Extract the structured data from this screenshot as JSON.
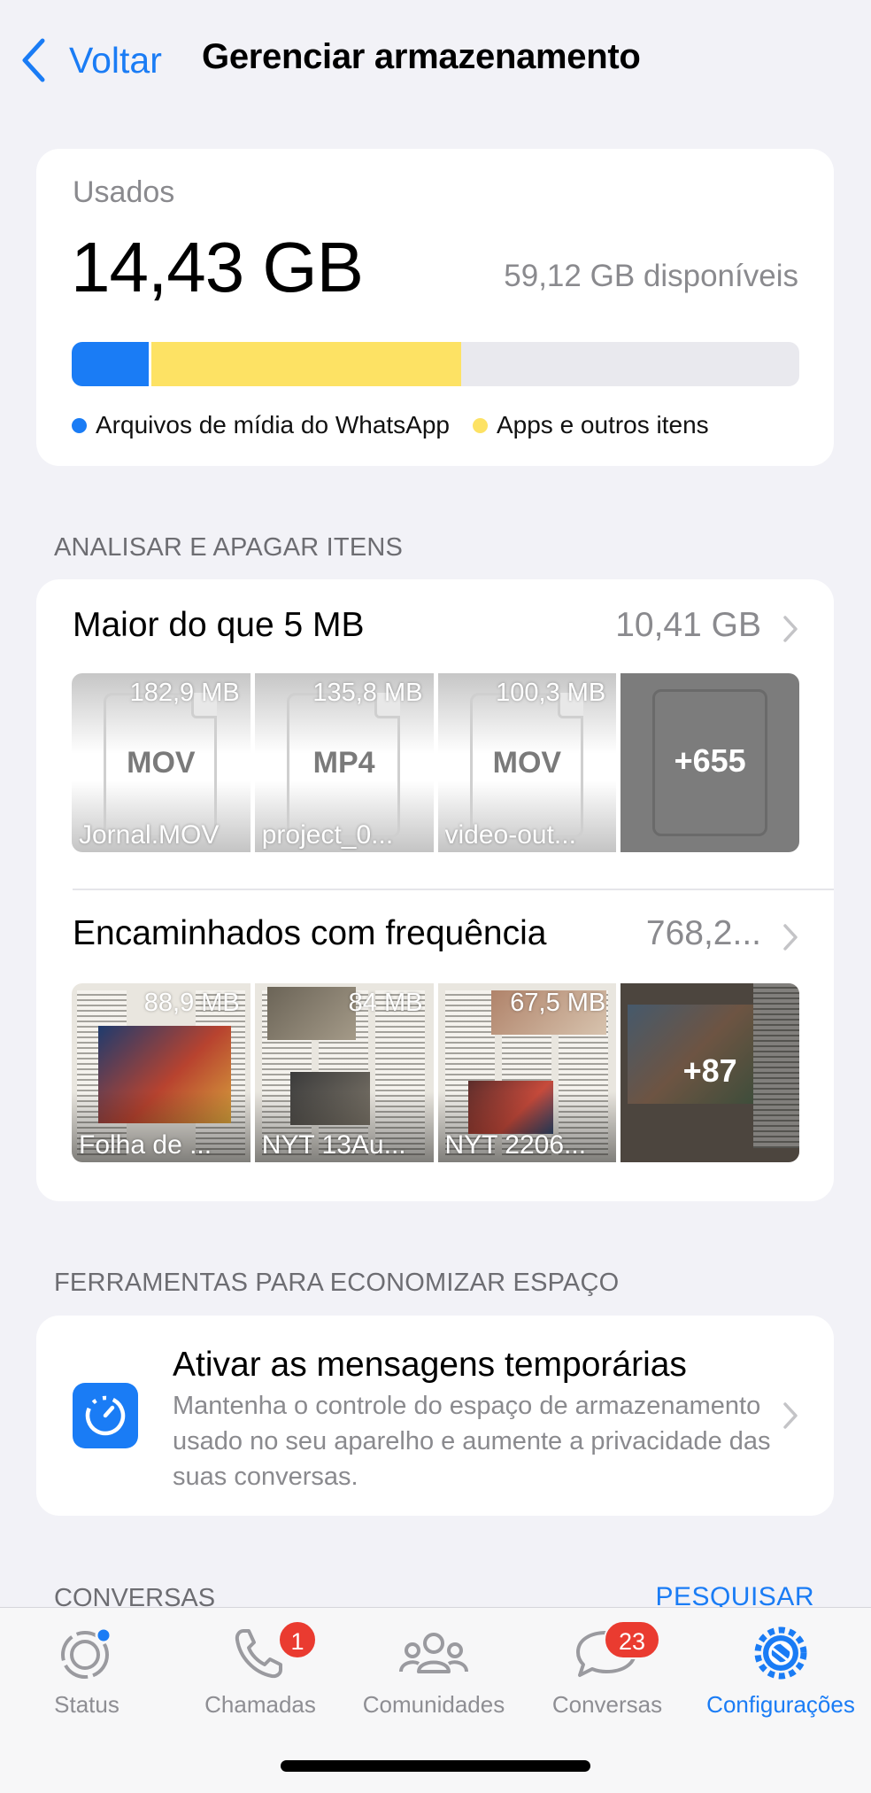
{
  "header": {
    "back_label": "Voltar",
    "title": "Gerenciar armazenamento"
  },
  "storage": {
    "used_label": "Usados",
    "used_value": "14,43 GB",
    "available": "59,12 GB disponíveis",
    "bar": {
      "whatsapp_fraction": 0.11,
      "apps_fraction": 0.425
    },
    "legend": [
      {
        "label": "Arquivos de mídia do WhatsApp",
        "color": "#1a7cf5"
      },
      {
        "label": "Apps e outros itens",
        "color": "#fde264"
      }
    ]
  },
  "review": {
    "section_label": "ANALISAR E APAGAR ITENS",
    "large": {
      "title": "Maior do que 5 MB",
      "size": "10,41 GB",
      "items": [
        {
          "size": "182,9 MB",
          "ext": "MOV",
          "name": "Jornal.MOV"
        },
        {
          "size": "135,8 MB",
          "ext": "MP4",
          "name": "project_0..."
        },
        {
          "size": "100,3 MB",
          "ext": "MOV",
          "name": "video-out..."
        }
      ],
      "more": "+655"
    },
    "forwarded": {
      "title": "Encaminhados com frequência",
      "size": "768,2...",
      "items": [
        {
          "size": "88,9 MB",
          "name": "Folha de ..."
        },
        {
          "size": "84 MB",
          "name": "NYT 13Au..."
        },
        {
          "size": "67,5 MB",
          "name": "NYT 2206..."
        }
      ],
      "more": "+87"
    }
  },
  "tools": {
    "section_label": "FERRAMENTAS PARA ECONOMIZAR ESPAÇO",
    "title": "Ativar as mensagens temporárias",
    "description": "Mantenha o controle do espaço de armazenamento usado no seu aparelho e aumente a privacidade das suas conversas."
  },
  "conversations": {
    "section_label": "CONVERSAS",
    "search_label": "PESQUISAR"
  },
  "tabbar": {
    "tabs": [
      {
        "label": "Status",
        "icon": "status-icon"
      },
      {
        "label": "Chamadas",
        "icon": "phone-icon",
        "badge": "1"
      },
      {
        "label": "Comunidades",
        "icon": "communities-icon"
      },
      {
        "label": "Conversas",
        "icon": "chat-bubbles-icon",
        "badge": "23"
      },
      {
        "label": "Configurações",
        "icon": "gear-icon",
        "active": true
      }
    ]
  }
}
